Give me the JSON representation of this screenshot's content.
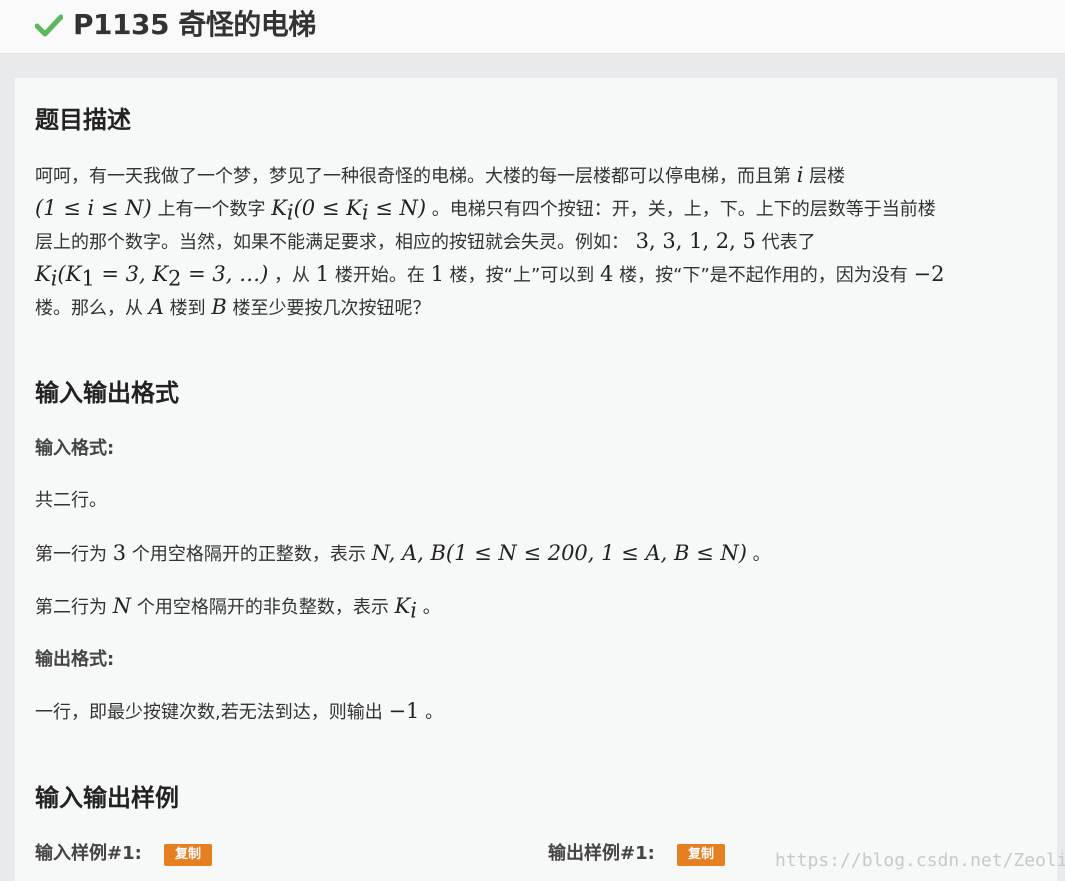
{
  "header": {
    "title": "P1135 奇怪的电梯",
    "status_color": "#5cb85c"
  },
  "sections": {
    "description": {
      "heading": "题目描述",
      "line1": {
        "t1": "呵呵，有一天我做了一个梦，梦见了一种很奇怪的电梯。大楼的每一层楼都可以停电梯，而且第 ",
        "m1": "i",
        "t2": " 层楼"
      },
      "line2": {
        "m1": "(1 ≤ i ≤ N)",
        "t1": " 上有一个数字 ",
        "m2": "K",
        "m2sub": "i",
        "m3": "(0 ≤ K",
        "m3sub": "i",
        "m4": " ≤ N)",
        "t2": " 。电梯只有四个按钮：开，关，上，下。上下的层数等于当前楼"
      },
      "line3": {
        "t1": "层上的那个数字。当然，如果不能满足要求，相应的按钮就会失灵。例如：",
        "m1": " 3, 3, 1, 2, 5",
        "t2": " 代表了"
      },
      "line4": {
        "m1": "K",
        "m1sub": "i",
        "m2": "(K",
        "m2sub": "1",
        "m3": " = 3, K",
        "m3sub": "2",
        "m4": " = 3, …)",
        "t1": " ，从 ",
        "m5": "1",
        "t2": " 楼开始。在 ",
        "m6": "1",
        "t3": " 楼，按“上”可以到 ",
        "m7": "4",
        "t4": " 楼，按“下”是不起作用的，因为没有 ",
        "m8": "−2"
      },
      "line5": {
        "t1": "楼。那么，从 ",
        "m1": "A",
        "t2": " 楼到 ",
        "m2": "B",
        "t3": " 楼至少要按几次按钮呢？"
      }
    },
    "io_format": {
      "heading": "输入输出格式",
      "input_label": "输入格式:",
      "input_line1": "共二行。",
      "input_line2": {
        "t1": "第一行为 ",
        "m1": "3",
        "t2": " 个用空格隔开的正整数，表示 ",
        "m2": "N, A, B(1 ≤ N ≤ 200, 1 ≤ A, B ≤ N)",
        "t3": " 。"
      },
      "input_line3": {
        "t1": "第二行为 ",
        "m1": "N",
        "t2": " 个用空格隔开的非负整数，表示 ",
        "m2": "K",
        "m2sub": "i",
        "t3": " 。"
      },
      "output_label": "输出格式:",
      "output_line1": {
        "t1": "一行，即最少按键次数,若无法到达，则输出 ",
        "m1": "−1",
        "t2": " 。"
      }
    },
    "samples": {
      "heading": "输入输出样例",
      "input_label": "输入样例#1:",
      "output_label": "输出样例#1:",
      "copy_label": "复制",
      "copy_color": "#e67e22"
    }
  },
  "watermark": "https://blog.csdn.net/Zeolim"
}
